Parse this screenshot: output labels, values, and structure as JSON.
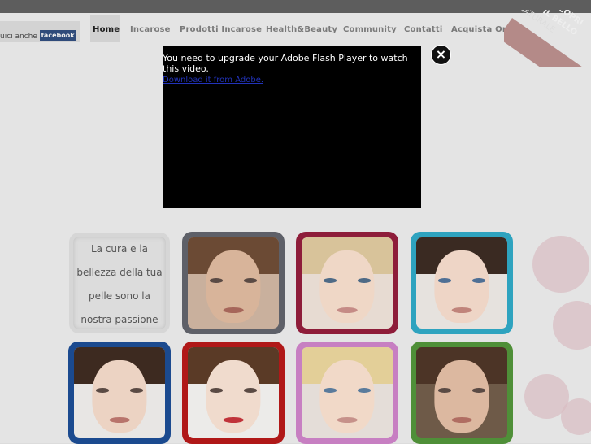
{
  "facebook": {
    "prefix": "uici anche su",
    "badge": "facebook"
  },
  "nav": {
    "items": [
      {
        "label": "Home",
        "active": true
      },
      {
        "label": "Incarose",
        "active": false
      },
      {
        "label": "Prodotti Incarose",
        "active": false
      },
      {
        "label": "Health&Beauty",
        "active": false
      },
      {
        "label": "Community",
        "active": false
      },
      {
        "label": "Contatti",
        "active": false
      },
      {
        "label": "Acquista Online",
        "active": false
      }
    ]
  },
  "ribbon": {
    "line1": "SCOPRI",
    "line2": "IL BELLO",
    "line3": "NATURALE"
  },
  "flash": {
    "message": "You need to upgrade your Adobe Flash Player to watch this video.",
    "link_text": "Download it from Adobe."
  },
  "close_icon": "close-icon",
  "tagline": {
    "lines": [
      "La cura e la",
      "bellezza della tua",
      "pelle sono la",
      "nostra passione"
    ]
  },
  "colors": {
    "tile_gray": "#5e6068",
    "tile_crimson": "#8e1d3a",
    "tile_teal": "#2ea3bf",
    "tile_blue": "#1b4a8f",
    "tile_red": "#b01818",
    "tile_pink": "#c77fc2",
    "tile_green": "#4f8f38"
  }
}
